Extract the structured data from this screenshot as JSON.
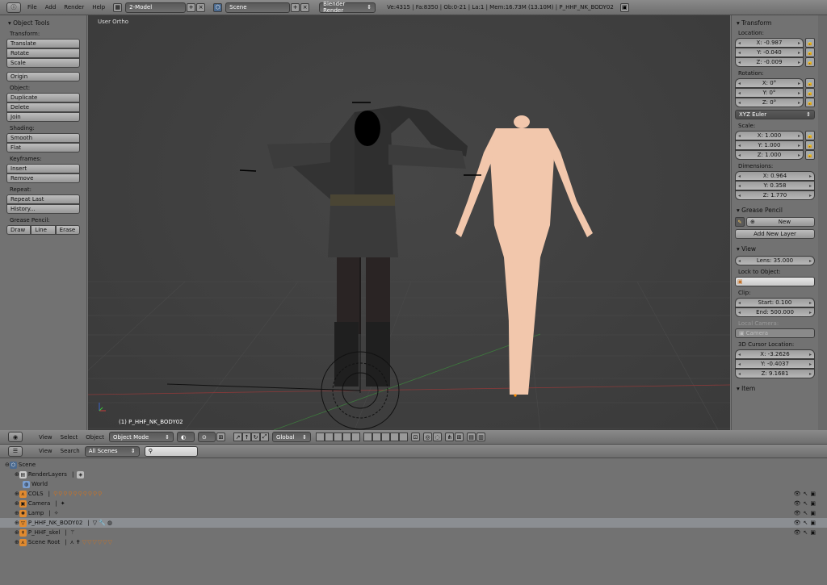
{
  "topbar": {
    "menus": [
      "File",
      "Add",
      "Render",
      "Help"
    ],
    "screen_layout": "2-Model",
    "scene": "Scene",
    "render_engine": "Blender Render",
    "stats": "Ve:4315 | Fa:8350 | Ob:0-21 | La:1 | Mem:16.73M (13.10M) | P_HHF_NK_BODY02"
  },
  "tools": {
    "title": "Object Tools",
    "transform_label": "Transform:",
    "translate": "Translate",
    "rotate": "Rotate",
    "scale": "Scale",
    "origin": "Origin",
    "object_label": "Object:",
    "duplicate": "Duplicate",
    "delete": "Delete",
    "join": "Join",
    "shading_label": "Shading:",
    "smooth": "Smooth",
    "flat": "Flat",
    "keyframes_label": "Keyframes:",
    "insert": "Insert",
    "remove": "Remove",
    "repeat_label": "Repeat:",
    "repeat_last": "Repeat Last",
    "history": "History...",
    "grease_label": "Grease Pencil:",
    "draw": "Draw",
    "line": "Line",
    "erase": "Erase"
  },
  "viewport": {
    "view_label": "User Ortho",
    "object_label": "(1) P_HHF_NK_BODY02"
  },
  "props": {
    "transform_title": "Transform",
    "location_label": "Location:",
    "loc_x": "X: -0.987",
    "loc_y": "Y: -0.040",
    "loc_z": "Z: -0.009",
    "rotation_label": "Rotation:",
    "rot_x": "X: 0°",
    "rot_y": "Y: 0°",
    "rot_z": "Z: 0°",
    "rotation_mode": "XYZ Euler",
    "scale_label": "Scale:",
    "scale_x": "X: 1.000",
    "scale_y": "Y: 1.000",
    "scale_z": "Z: 1.000",
    "dimensions_label": "Dimensions:",
    "dim_x": "X: 0.964",
    "dim_y": "Y: 0.358",
    "dim_z": "Z: 1.770",
    "grease_title": "Grease Pencil",
    "new": "New",
    "add_layer": "Add New Layer",
    "view_title": "View",
    "lens": "Lens: 35.000",
    "lock_label": "Lock to Object:",
    "clip_label": "Clip:",
    "clip_start": "Start: 0.100",
    "clip_end": "End: 500.000",
    "local_camera_label": "Local Camera:",
    "camera": "Camera",
    "cursor_label": "3D Cursor Location:",
    "cur_x": "X: -3.2626",
    "cur_y": "Y: -0.4037",
    "cur_z": "Z: 9.1681",
    "item_title": "Item"
  },
  "vheader": {
    "menus": [
      "View",
      "Select",
      "Object"
    ],
    "mode": "Object Mode",
    "orientation": "Global"
  },
  "oheader": {
    "menus": [
      "View",
      "Search"
    ],
    "filter": "All Scenes"
  },
  "outliner": {
    "rows": [
      {
        "name": "Scene"
      },
      {
        "name": "RenderLayers"
      },
      {
        "name": "World"
      },
      {
        "name": "COLS"
      },
      {
        "name": "Camera"
      },
      {
        "name": "Lamp"
      },
      {
        "name": "P_HHF_NK_BODY02"
      },
      {
        "name": "P_HHF_skel"
      },
      {
        "name": "Scene Root"
      }
    ]
  },
  "colors": {
    "header": "#7a7a7a",
    "viewport": "#3d3d3d",
    "highlight": "#8b8e92",
    "accent": "#c4732a"
  }
}
